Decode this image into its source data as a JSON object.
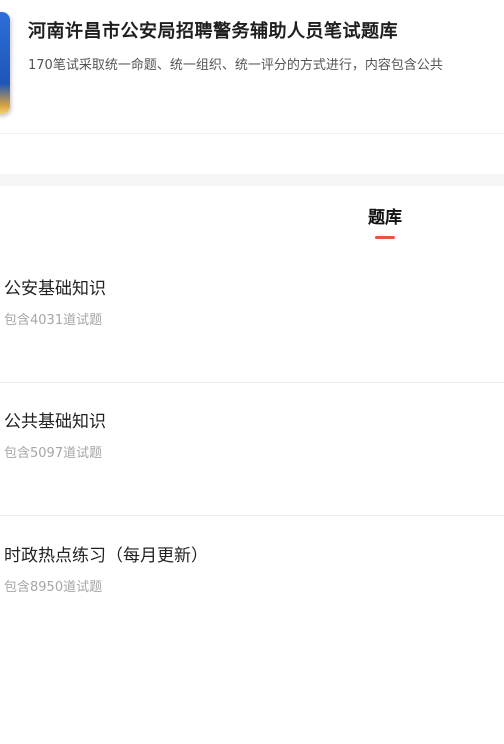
{
  "header": {
    "title": "河南许昌市公安局招聘警务辅助人员笔试题库",
    "description": "170笔试采取统一命题、统一组织、统一评分的方式进行，内容包含公共"
  },
  "tabs": [
    {
      "label": "题库",
      "active": true
    }
  ],
  "accent_color": "#e8563a",
  "list": [
    {
      "title": "公安基础知识",
      "subtitle": "包含4031道试题"
    },
    {
      "title": "公共基础知识",
      "subtitle": "包含5097道试题"
    },
    {
      "title": "时政热点练习（每月更新）",
      "subtitle": "包含8950道试题"
    }
  ]
}
